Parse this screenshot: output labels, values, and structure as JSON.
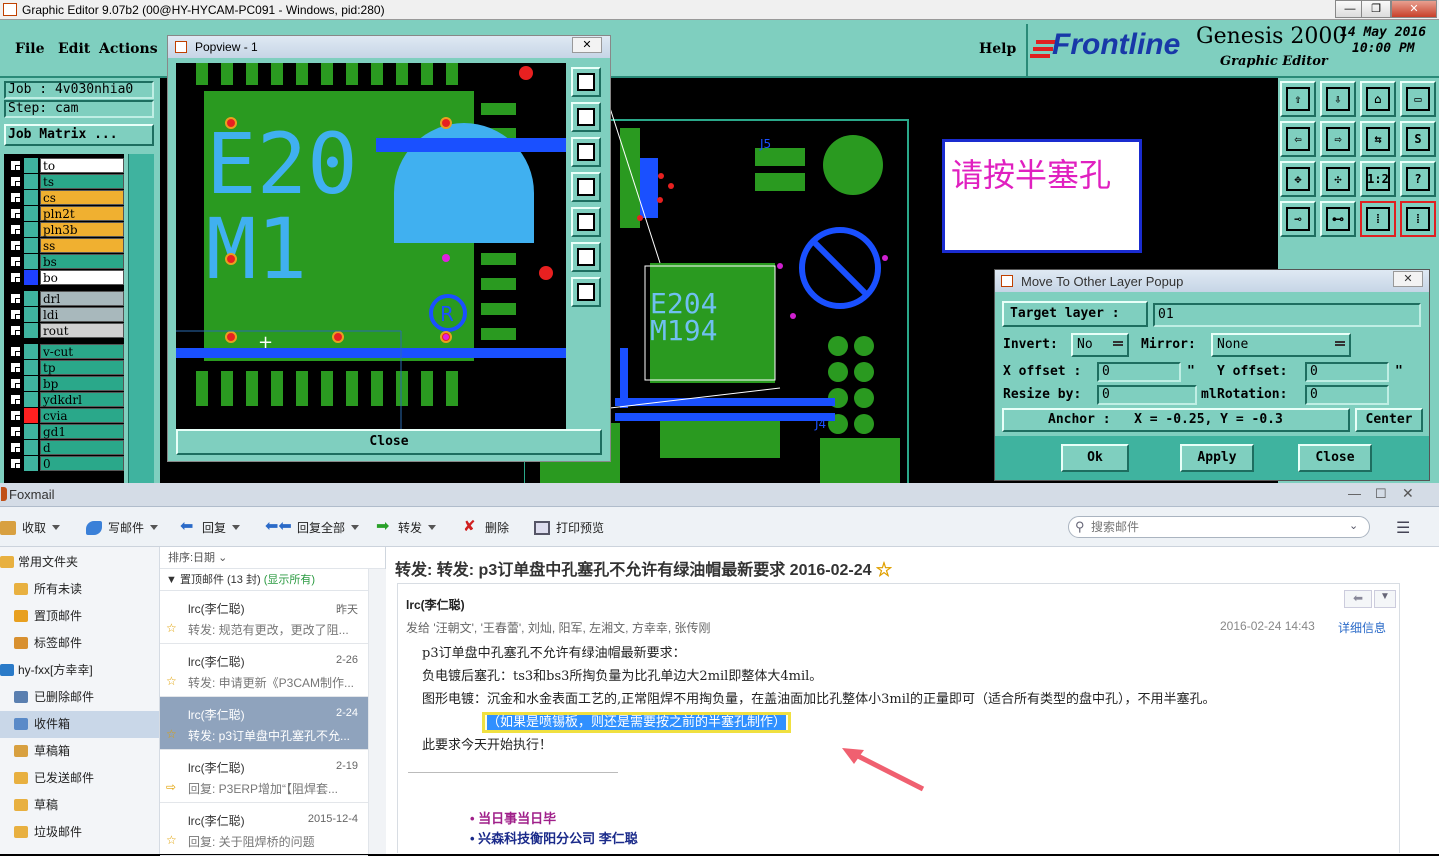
{
  "window": {
    "title": "Graphic Editor 9.07b2 (00@HY-HYCAM-PC091 - Windows, pid:280)"
  },
  "menu": {
    "file": "File",
    "edit": "Edit",
    "actions": "Actions",
    "help": "Help"
  },
  "brand": {
    "logo": "Frontline",
    "product": "Genesis 2000",
    "subtitle": "Graphic Editor",
    "date": "14 May 2016",
    "time": "10:00 PM"
  },
  "job": {
    "job_label": "Job : 4v030nhia0",
    "step_label": "Step: cam",
    "matrix_button": "Job Matrix ..."
  },
  "layers": [
    {
      "name": "to",
      "color": "#ffffff",
      "swatch": "#3fb39f"
    },
    {
      "name": "ts",
      "color": "#2aa88a",
      "swatch": "#3fb39f"
    },
    {
      "name": "cs",
      "color": "#f0b030",
      "swatch": "#3fb39f"
    },
    {
      "name": "pln2t",
      "color": "#f0b030",
      "swatch": "#3fb39f"
    },
    {
      "name": "pln3b",
      "color": "#f0b030",
      "swatch": "#3fb39f"
    },
    {
      "name": "ss",
      "color": "#f0b030",
      "swatch": "#3fb39f"
    },
    {
      "name": "bs",
      "color": "#2aa88a",
      "swatch": "#3fb39f"
    },
    {
      "name": "bo",
      "color": "#ffffff",
      "swatch": "#1e40ff"
    },
    {
      "name": "drl",
      "color": "#a8b8bc",
      "swatch": "#3fb39f"
    },
    {
      "name": "ldi",
      "color": "#a8b8bc",
      "swatch": "#3fb39f"
    },
    {
      "name": "rout",
      "color": "#d0d0d0",
      "swatch": "#3fb39f"
    },
    {
      "name": "v-cut",
      "color": "#2aa88a",
      "swatch": "#3fb39f"
    },
    {
      "name": "tp",
      "color": "#2aa88a",
      "swatch": "#3fb39f"
    },
    {
      "name": "bp",
      "color": "#2aa88a",
      "swatch": "#3fb39f"
    },
    {
      "name": "ydkdrl",
      "color": "#2aa88a",
      "swatch": "#3fb39f"
    },
    {
      "name": "cvia",
      "color": "#2aa88a",
      "swatch": "#ff2020"
    },
    {
      "name": "gd1",
      "color": "#2aa88a",
      "swatch": "#3fb39f"
    },
    {
      "name": "d",
      "color": "#2aa88a",
      "swatch": "#3fb39f"
    },
    {
      "name": "0",
      "color": "#2aa88a",
      "swatch": "#3fb39f"
    }
  ],
  "popview": {
    "title": "Popview - 1",
    "close": "Close",
    "board_text_1": "E20",
    "board_text_2": "M1"
  },
  "canvas": {
    "annotation": "请按半塞孔",
    "board_text_1": "E204",
    "board_text_2": "M194",
    "label_j4": "J4",
    "label_j5": "J5"
  },
  "move_popup": {
    "title": "Move To Other Layer Popup",
    "target_label": "Target layer :",
    "target_value": "01",
    "invert_label": "Invert:",
    "invert_value": "No",
    "mirror_label": "Mirror:",
    "mirror_value": "None",
    "xoffset_label": "X offset :",
    "xoffset_value": "0",
    "xoffset_unit": "\"",
    "yoffset_label": "Y offset:",
    "yoffset_value": "0",
    "yoffset_unit": "\"",
    "resize_label": "Resize by:",
    "resize_value": "0",
    "resize_unit": "ml",
    "rotation_label": "Rotation:",
    "rotation_value": "0",
    "anchor_text": "Anchor :   X = -0.25, Y = -0.3",
    "center": "Center",
    "ok": "Ok",
    "apply": "Apply",
    "close": "Close"
  },
  "foxmail": {
    "title": "Foxmail",
    "toolbar": {
      "receive": "收取",
      "compose": "写邮件",
      "reply": "回复",
      "reply_all": "回复全部",
      "forward": "转发",
      "delete": "删除",
      "print_preview": "打印预览"
    },
    "search_placeholder": "搜索邮件",
    "folders": [
      {
        "label": "常用文件夹",
        "icon": "folder-icon"
      },
      {
        "label": "所有未读",
        "icon": "folder-icon"
      },
      {
        "label": "置顶邮件",
        "icon": "star-icon"
      },
      {
        "label": "标签邮件",
        "icon": "tag-icon"
      },
      {
        "label": "hy-fxx[方幸幸]",
        "icon": "account-icon"
      },
      {
        "label": "已删除邮件",
        "icon": "trash-icon"
      },
      {
        "label": "收件箱",
        "icon": "inbox-icon"
      },
      {
        "label": "草稿箱",
        "icon": "draft-icon"
      },
      {
        "label": "已发送邮件",
        "icon": "sent-icon"
      },
      {
        "label": "草稿",
        "icon": "folder-icon"
      },
      {
        "label": "垃圾邮件",
        "icon": "folder-icon"
      }
    ],
    "list_header": {
      "sort": "排序:日期",
      "pinned": "置顶邮件 (13 封)",
      "show_all": "(显示所有)"
    },
    "messages": [
      {
        "from": "lrc(李仁聪)",
        "date": "昨天",
        "subject": "转发: 规范有更改，更改了阻..."
      },
      {
        "from": "lrc(李仁聪)",
        "date": "2-26",
        "subject": "转发: 申请更新《P3CAM制作..."
      },
      {
        "from": "lrc(李仁聪)",
        "date": "2-24",
        "subject": "转发: p3订单盘中孔塞孔不允..."
      },
      {
        "from": "lrc(李仁聪)",
        "date": "2-19",
        "subject": "回复: P3ERP增加“【阻焊套..."
      },
      {
        "from": "lrc(李仁聪)",
        "date": "2015-12-4",
        "subject": "回复: 关于阻焊桥的问题"
      }
    ],
    "reader": {
      "subject": "转发: 转发: p3订单盘中孔塞孔不允许有绿油帽最新要求 2016-02-24",
      "sender": "lrc(李仁聪)",
      "recipients": "发给 '汪朝文', '王春蕾', 刘灿, 阳军, 左湘文, 方幸幸, 张传刚",
      "datetime": "2016-02-24 14:43",
      "details": "详细信息",
      "line1": "p3订单盘中孔塞孔不允许有绿油帽最新要求：",
      "line2": "负电镀后塞孔：ts3和bs3所掏负量为比孔单边大2mil即整体大4mil。",
      "line3": "图形电镀：沉金和水金表面工艺的,正常阻焊不用掏负量，在盖油面加比孔整体小3mil的正量即可（适合所有类型的盘中孔），不用半塞孔。",
      "line4": "（如果是喷锡板，则还是需要按之前的半塞孔制作）",
      "line5": "此要求今天开始执行！",
      "sig1": "当日事当日毕",
      "sig2": "兴森科技衡阳分公司  李仁聪"
    }
  }
}
